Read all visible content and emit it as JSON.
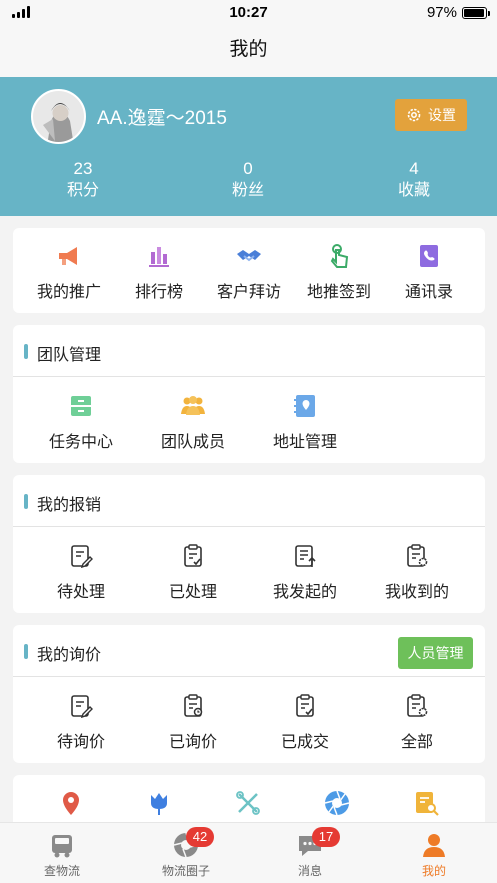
{
  "status_bar": {
    "time": "10:27",
    "battery": "97%"
  },
  "header": {
    "title": "我的"
  },
  "profile": {
    "username": "AA.逸霆～2015",
    "settings_label": "设置",
    "stats": [
      {
        "value": "23",
        "label": "积分"
      },
      {
        "value": "0",
        "label": "粉丝"
      },
      {
        "value": "4",
        "label": "收藏"
      }
    ]
  },
  "quick_menu": [
    {
      "label": "我的推广",
      "icon": "megaphone-icon",
      "color": "#f07b50"
    },
    {
      "label": "排行榜",
      "icon": "bar-chart-icon",
      "color": "#b26ad2"
    },
    {
      "label": "客户拜访",
      "icon": "handshake-icon",
      "color": "#4a7fd8"
    },
    {
      "label": "地推签到",
      "icon": "tap-hand-icon",
      "color": "#3cab68"
    },
    {
      "label": "通讯录",
      "icon": "address-book-icon",
      "color": "#8e6be0"
    }
  ],
  "team": {
    "title": "团队管理",
    "items": [
      {
        "label": "任务中心",
        "icon": "task-box-icon",
        "color": "#6fcf97"
      },
      {
        "label": "团队成员",
        "icon": "team-members-icon",
        "color": "#f2b33d"
      },
      {
        "label": "地址管理",
        "icon": "location-book-icon",
        "color": "#6ba8e8"
      }
    ]
  },
  "reimburse": {
    "title": "我的报销",
    "items": [
      {
        "label": "待处理",
        "icon": "pending-doc-icon"
      },
      {
        "label": "已处理",
        "icon": "processed-doc-icon"
      },
      {
        "label": "我发起的",
        "icon": "initiated-doc-icon"
      },
      {
        "label": "我收到的",
        "icon": "received-doc-icon"
      }
    ]
  },
  "inquiry": {
    "title": "我的询价",
    "manage_label": "人员管理",
    "items": [
      {
        "label": "待询价",
        "icon": "pending-inquiry-icon"
      },
      {
        "label": "已询价",
        "icon": "inquired-icon"
      },
      {
        "label": "已成交",
        "icon": "deal-closed-icon"
      },
      {
        "label": "全部",
        "icon": "all-inquiry-icon"
      }
    ]
  },
  "more_icons": [
    {
      "icon": "map-pin-icon",
      "color": "#e05a47"
    },
    {
      "icon": "tulip-icon",
      "color": "#3f7fe0"
    },
    {
      "icon": "tools-icon",
      "color": "#6cc3c5"
    },
    {
      "icon": "aperture-icon",
      "color": "#4d9be6"
    },
    {
      "icon": "search-doc-icon",
      "color": "#f0b43a"
    }
  ],
  "tabbar": [
    {
      "label": "查物流",
      "icon": "truck-icon",
      "badge": ""
    },
    {
      "label": "物流圈子",
      "icon": "aperture-tab-icon",
      "badge": "42"
    },
    {
      "label": "消息",
      "icon": "message-icon",
      "badge": "17"
    },
    {
      "label": "我的",
      "icon": "person-icon",
      "badge": "",
      "active": true
    }
  ]
}
